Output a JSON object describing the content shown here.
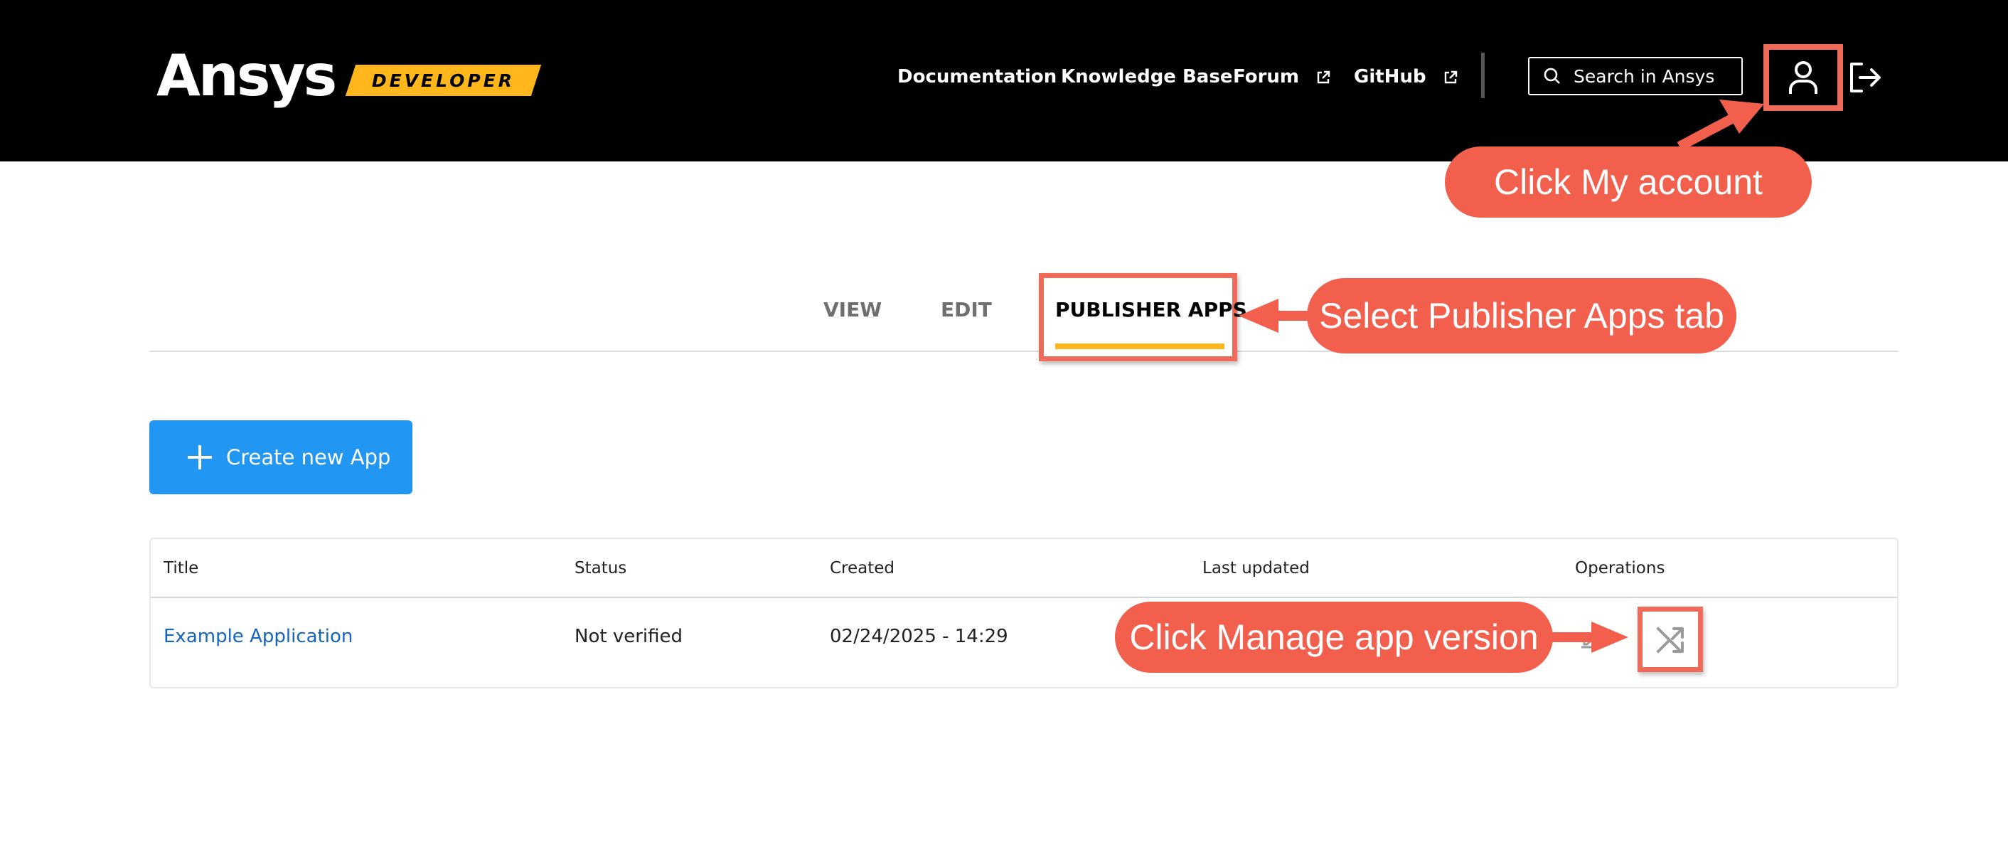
{
  "header": {
    "logo_text": "Ansys",
    "logo_badge": "DEVELOPER",
    "nav": {
      "documentation": "Documentation",
      "knowledge_base": "Knowledge Base",
      "forum": "Forum",
      "github": "GitHub"
    },
    "search_placeholder": "Search in Ansys",
    "account_icon": "user-icon",
    "logout_icon": "logout-icon"
  },
  "tabs": {
    "view": "VIEW",
    "edit": "EDIT",
    "publisher_apps": "PUBLISHER APPS",
    "active": "PUBLISHER APPS"
  },
  "create_button": {
    "label": "Create new App",
    "icon": "plus-icon"
  },
  "table": {
    "columns": [
      "Title",
      "Status",
      "Created",
      "Last updated",
      "Operations"
    ],
    "rows": [
      {
        "title": "Example Application",
        "status": "Not verified",
        "created": "02/24/2025 - 14:29",
        "last_updated": "",
        "operations": [
          "edit-icon",
          "shuffle-icon"
        ]
      }
    ]
  },
  "annotations": {
    "callout_account": "Click My account",
    "callout_tab": "Select Publisher Apps tab",
    "callout_manage": "Click Manage app version"
  },
  "colors": {
    "header_bg": "#000000",
    "brand_yellow": "#ffb71b",
    "primary_blue": "#2196f3",
    "link_blue": "#1565c0",
    "annotation_red": "#f25f4c"
  }
}
